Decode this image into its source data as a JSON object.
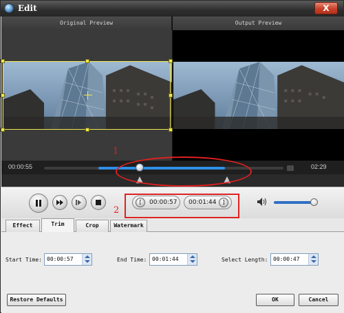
{
  "window": {
    "title": "Edit",
    "close_label": "X"
  },
  "preview": {
    "original_label": "Original Preview",
    "output_label": "Output Preview"
  },
  "timeline": {
    "current_time": "00:00:55",
    "total_time": "02:29",
    "selection_start_fraction": 0.38,
    "selection_end_fraction": 0.9,
    "playhead_fraction": 0.4
  },
  "controls": {
    "start_time": "00:00:57",
    "end_time": "00:01:44",
    "volume_fraction": 0.9
  },
  "tabs": [
    {
      "label": "Effect",
      "active": false
    },
    {
      "label": "Trim",
      "active": true
    },
    {
      "label": "Crop",
      "active": false
    },
    {
      "label": "Watermark",
      "active": false
    }
  ],
  "trim": {
    "start_label": "Start Time:",
    "start_value": "00:00:57",
    "end_label": "End Time:",
    "end_value": "00:01:44",
    "length_label": "Select Length:",
    "length_value": "00:00:47"
  },
  "buttons": {
    "restore": "Restore Defaults",
    "ok": "OK",
    "cancel": "Cancel"
  },
  "annotations": {
    "marker_1": "1",
    "marker_2": "2",
    "color": "#e02020"
  },
  "icons": {
    "app": "app-logo-icon",
    "pause": "pause-icon",
    "fast_forward": "fast-forward-icon",
    "next_frame": "next-frame-icon",
    "stop": "stop-icon",
    "volume": "volume-icon"
  }
}
